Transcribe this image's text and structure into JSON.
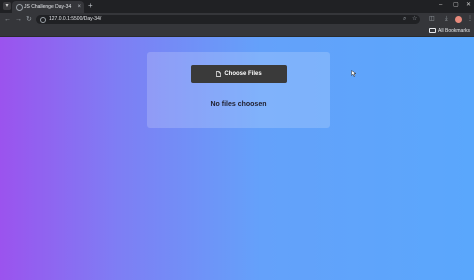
{
  "browser": {
    "tab": {
      "title": "JS Challenge Day-34"
    },
    "url": "127.0.0.1:5500/Day-34/",
    "bookmarks": {
      "label": "All Bookmarks"
    },
    "new_tab_symbol": "+",
    "close_symbol": "×",
    "window_controls": {
      "minimize": "–",
      "maximize": "▢",
      "close": "✕"
    }
  },
  "upload_card": {
    "button_label": "Choose Files",
    "status": "No files choosen"
  }
}
